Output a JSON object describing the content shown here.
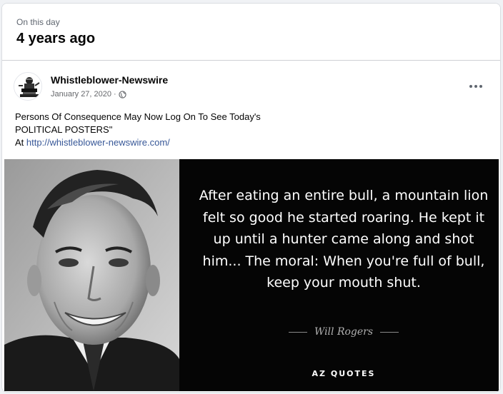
{
  "memory": {
    "label": "On this day",
    "title": "4 years ago"
  },
  "post": {
    "author": "Whistleblower-Newswire",
    "date": "January 27, 2020",
    "separator": "·",
    "privacy_icon": "globe-icon",
    "more_icon": "more-options-icon",
    "text_line1": "Persons Of Consequence May Now Log On To See Today's",
    "text_line2": "POLITICAL POSTERS\"",
    "text_prefix": "At",
    "link": "http://whistleblower-newswire.com/"
  },
  "quote_image": {
    "quote": "After eating an entire bull, a mountain lion felt so good he started roaring. He kept it up until a hunter came along and shot him... The moral: When you're full of bull, keep your mouth shut.",
    "author": "Will Rogers",
    "logo": "AZ QUOTES"
  },
  "colors": {
    "link": "#385898",
    "quote_bg": "#050505",
    "card_bg": "#ffffff"
  }
}
